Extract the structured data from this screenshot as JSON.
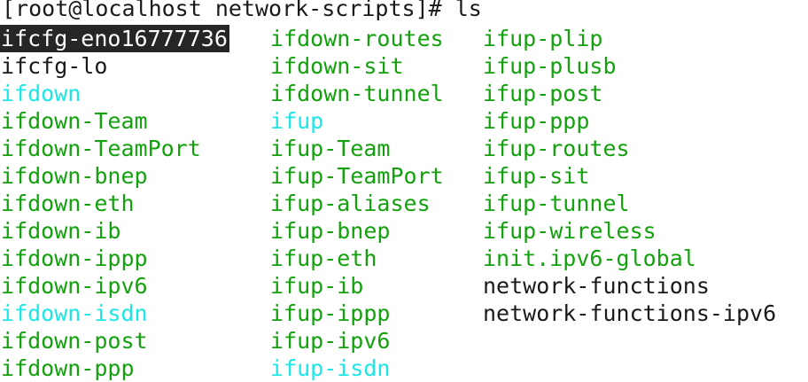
{
  "colors": {
    "background": "#ffffff",
    "regular": "#1a1a1a",
    "executable": "#13a10e",
    "symlink": "#1fe6e6",
    "selection_bg": "#262626",
    "selection_fg": "#ffffff"
  },
  "prompt": {
    "text": "[root@localhost network-scripts]# ls"
  },
  "listing": {
    "columns": [
      [
        {
          "name": "ifcfg-eno16777736",
          "type": "regular",
          "selected": true
        },
        {
          "name": "ifcfg-lo",
          "type": "regular"
        },
        {
          "name": "ifdown",
          "type": "symlink"
        },
        {
          "name": "ifdown-Team",
          "type": "executable"
        },
        {
          "name": "ifdown-TeamPort",
          "type": "executable"
        },
        {
          "name": "ifdown-bnep",
          "type": "executable"
        },
        {
          "name": "ifdown-eth",
          "type": "executable"
        },
        {
          "name": "ifdown-ib",
          "type": "executable"
        },
        {
          "name": "ifdown-ippp",
          "type": "executable"
        },
        {
          "name": "ifdown-ipv6",
          "type": "executable"
        },
        {
          "name": "ifdown-isdn",
          "type": "symlink"
        },
        {
          "name": "ifdown-post",
          "type": "executable"
        },
        {
          "name": "ifdown-ppp",
          "type": "executable"
        }
      ],
      [
        {
          "name": "ifdown-routes",
          "type": "executable"
        },
        {
          "name": "ifdown-sit",
          "type": "executable"
        },
        {
          "name": "ifdown-tunnel",
          "type": "executable"
        },
        {
          "name": "ifup",
          "type": "symlink"
        },
        {
          "name": "ifup-Team",
          "type": "executable"
        },
        {
          "name": "ifup-TeamPort",
          "type": "executable"
        },
        {
          "name": "ifup-aliases",
          "type": "executable"
        },
        {
          "name": "ifup-bnep",
          "type": "executable"
        },
        {
          "name": "ifup-eth",
          "type": "executable"
        },
        {
          "name": "ifup-ib",
          "type": "executable"
        },
        {
          "name": "ifup-ippp",
          "type": "executable"
        },
        {
          "name": "ifup-ipv6",
          "type": "executable"
        },
        {
          "name": "ifup-isdn",
          "type": "symlink"
        }
      ],
      [
        {
          "name": "ifup-plip",
          "type": "executable"
        },
        {
          "name": "ifup-plusb",
          "type": "executable"
        },
        {
          "name": "ifup-post",
          "type": "executable"
        },
        {
          "name": "ifup-ppp",
          "type": "executable"
        },
        {
          "name": "ifup-routes",
          "type": "executable"
        },
        {
          "name": "ifup-sit",
          "type": "executable"
        },
        {
          "name": "ifup-tunnel",
          "type": "executable"
        },
        {
          "name": "ifup-wireless",
          "type": "executable"
        },
        {
          "name": "init.ipv6-global",
          "type": "executable"
        },
        {
          "name": "network-functions",
          "type": "regular"
        },
        {
          "name": "network-functions-ipv6",
          "type": "regular"
        }
      ]
    ]
  }
}
